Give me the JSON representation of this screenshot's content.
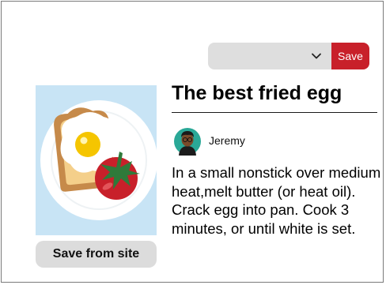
{
  "toolbar": {
    "board_select_value": "",
    "save_label": "Save",
    "chevron_icon": "chevron-down-icon"
  },
  "pin": {
    "image_icon": "fried-egg-on-toast-illustration",
    "save_from_site_label": "Save from site",
    "title": "The best fried egg",
    "author": {
      "name": "Jeremy",
      "avatar_icon": "avatar-icon"
    },
    "description": "In a small nonstick over medium heat,melt butter (or heat oil). Crack egg into pan. Cook 3 minutes, or until white is set."
  },
  "colors": {
    "accent": "#c8202a",
    "button_gray": "#dcdcdc",
    "image_background": "#c8e4f5",
    "avatar_background": "#2aa897"
  }
}
